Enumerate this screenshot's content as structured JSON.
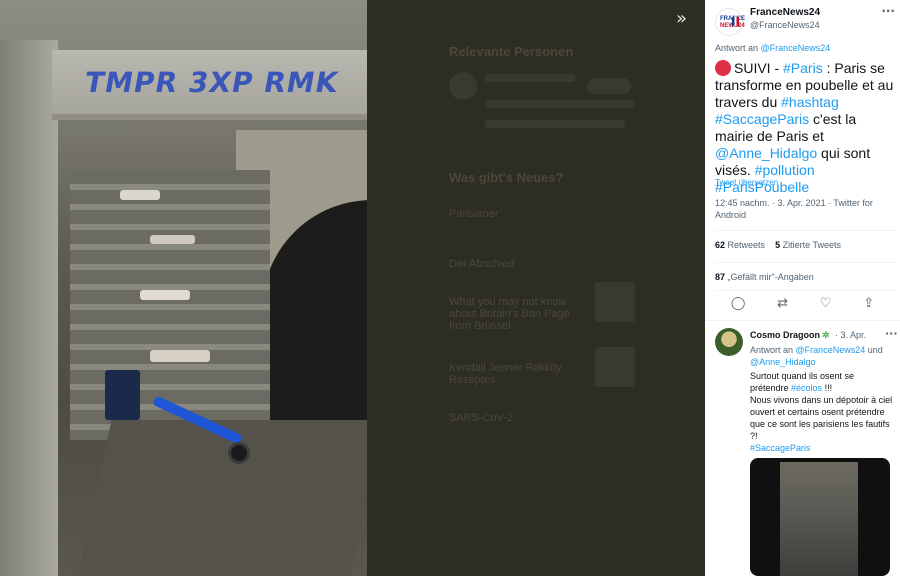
{
  "viewer": {
    "expand_icon": "chevrons-right-icon",
    "photo_graffiti": "TMPR 3XP RMK"
  },
  "background_page": {
    "section1_title": "Relevante Personen",
    "section2_title": "Was gibt's Neues?",
    "trend1": "Parisianer",
    "trend2": "Der Abschied",
    "news1": "What you may not know about Britain's Ban Page from Brüssel",
    "news2": "Kendall Jenner Rokkity Rezeptes",
    "trend3": "SARS-CoV-2"
  },
  "tweet": {
    "avatar_text_top": "FRANCE",
    "avatar_text_bottom": "NEWS24",
    "display_name": "FranceNews24",
    "handle": "@FranceNews24",
    "more_icon": "more-horizontal-icon",
    "reply_to_prefix": "Antwort an",
    "reply_to_handle": "@FranceNews24",
    "text_intro": "SUIVI - ",
    "hashtag_paris": "#Paris",
    "text_part1": " : Paris se transforme en poubelle et au travers du ",
    "hashtag_hashtag": "#hashtag",
    "hashtag_saccage": "#SaccageParis",
    "text_part2": " c'est la mairie de Paris et ",
    "mention_anne": "@Anne_Hidalgo",
    "text_part3": " qui sont visés. ",
    "hashtag_pollution": "#pollution",
    "hashtag_poubelle": "#ParisPoubelle",
    "translate_label": "Tweet übersetzen",
    "timestamp": "12:45 nachm. · 3. Apr. 2021 · Twitter for Android",
    "retweets_count": "62",
    "retweets_label": "Retweets",
    "quotes_count": "5",
    "quotes_label": "Zitierte Tweets",
    "likes_count": "87",
    "likes_label": "„Gefällt mir\"-Angaben",
    "actions": {
      "reply_icon": "reply-icon",
      "retweet_icon": "retweet-icon",
      "like_icon": "heart-icon",
      "share_icon": "share-icon"
    }
  },
  "reply": {
    "display_name": "Cosmo Dragoon",
    "name_emoji": "cactus-icon",
    "date": "· 3. Apr.",
    "reply_to_prefix": "Antwort an",
    "reply_to_handle1": "@FranceNews24",
    "reply_to_joiner": "und",
    "reply_to_handle2": "@Anne_Hidalgo",
    "text_part1": "Surtout quand ils osent se prétendre ",
    "hashtag_ecolos": "#écolos",
    "text_part2": " !!!",
    "text_part3": "Nous vivons dans un dépotoir à ciel ouvert et certains osent prétendre que ce sont les parisiens les fautifs ?!",
    "hashtag_saccage": "#SaccageParis"
  }
}
